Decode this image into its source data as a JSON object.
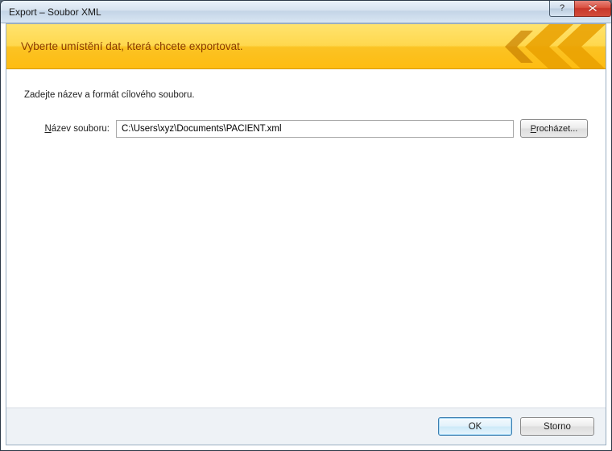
{
  "window": {
    "title": "Export – Soubor XML"
  },
  "band": {
    "heading": "Vyberte umístění dat, která chcete exportovat."
  },
  "content": {
    "instruction": "Zadejte název a formát cílového souboru.",
    "file_label_pre": "N",
    "file_label_post": "ázev souboru:",
    "file_value": "C:\\Users\\xyz\\Documents\\PACIENT.xml",
    "browse_pre": "P",
    "browse_post": "rocházet..."
  },
  "footer": {
    "ok": "OK",
    "cancel": "Storno"
  },
  "icons": {
    "help": "?",
    "close": "×"
  }
}
